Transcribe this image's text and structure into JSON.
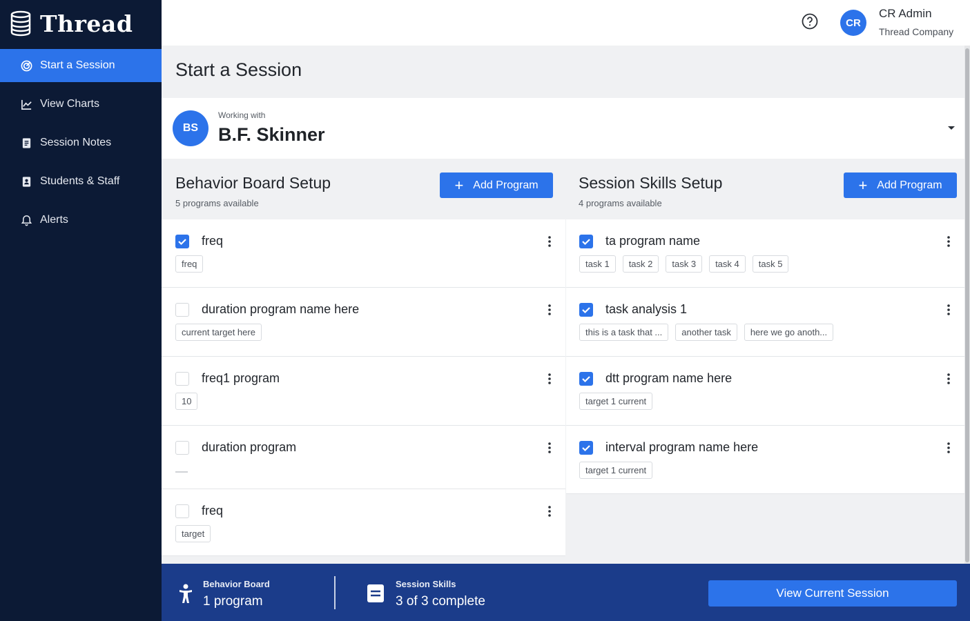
{
  "app": {
    "name": "Thread"
  },
  "sidebar": {
    "items": [
      {
        "label": "Start a Session",
        "icon": "target-icon",
        "active": true
      },
      {
        "label": "View Charts",
        "icon": "chart-line-icon",
        "active": false
      },
      {
        "label": "Session Notes",
        "icon": "document-icon",
        "active": false
      },
      {
        "label": "Students & Staff",
        "icon": "contacts-icon",
        "active": false
      },
      {
        "label": "Alerts",
        "icon": "bell-icon",
        "active": false
      }
    ]
  },
  "topbar": {
    "help_icon": "help-circle-icon",
    "user": {
      "initials": "CR",
      "name": "CR Admin",
      "company": "Thread Company"
    }
  },
  "page": {
    "title": "Start a Session"
  },
  "working_with": {
    "label": "Working with",
    "initials": "BS",
    "name": "B.F. Skinner"
  },
  "behavior_board": {
    "title": "Behavior Board Setup",
    "subtitle": "5 programs available",
    "add_label": "Add Program",
    "programs": [
      {
        "name": "freq",
        "checked": true,
        "tags": [
          "freq"
        ]
      },
      {
        "name": "duration program name here",
        "checked": false,
        "tags": [
          "current target here"
        ]
      },
      {
        "name": "freq1 program",
        "checked": false,
        "tags": [
          "10"
        ]
      },
      {
        "name": "duration program",
        "checked": false,
        "tags": []
      },
      {
        "name": "freq",
        "checked": false,
        "tags": [
          "target"
        ]
      }
    ]
  },
  "session_skills": {
    "title": "Session Skills Setup",
    "subtitle": "4 programs available",
    "add_label": "Add Program",
    "programs": [
      {
        "name": "ta program name",
        "checked": true,
        "tags": [
          "task 1",
          "task 2",
          "task 3",
          "task 4",
          "task 5"
        ]
      },
      {
        "name": "task analysis 1",
        "checked": true,
        "tags": [
          "this is a task that ...",
          "another task",
          "here we go anoth..."
        ]
      },
      {
        "name": "dtt program name here",
        "checked": true,
        "tags": [
          "target 1 current"
        ]
      },
      {
        "name": "interval program name here",
        "checked": true,
        "tags": [
          "target 1 current"
        ]
      }
    ]
  },
  "footer": {
    "behavior": {
      "label": "Behavior Board",
      "value": "1 program",
      "icon": "person-icon"
    },
    "skills": {
      "label": "Session Skills",
      "value": "3 of 3 complete",
      "icon": "list-box-icon"
    },
    "view_button": "View Current Session"
  },
  "colors": {
    "primary": "#2c73ea",
    "sidebar": "#0c1a35",
    "footer": "#1b3c8a"
  }
}
